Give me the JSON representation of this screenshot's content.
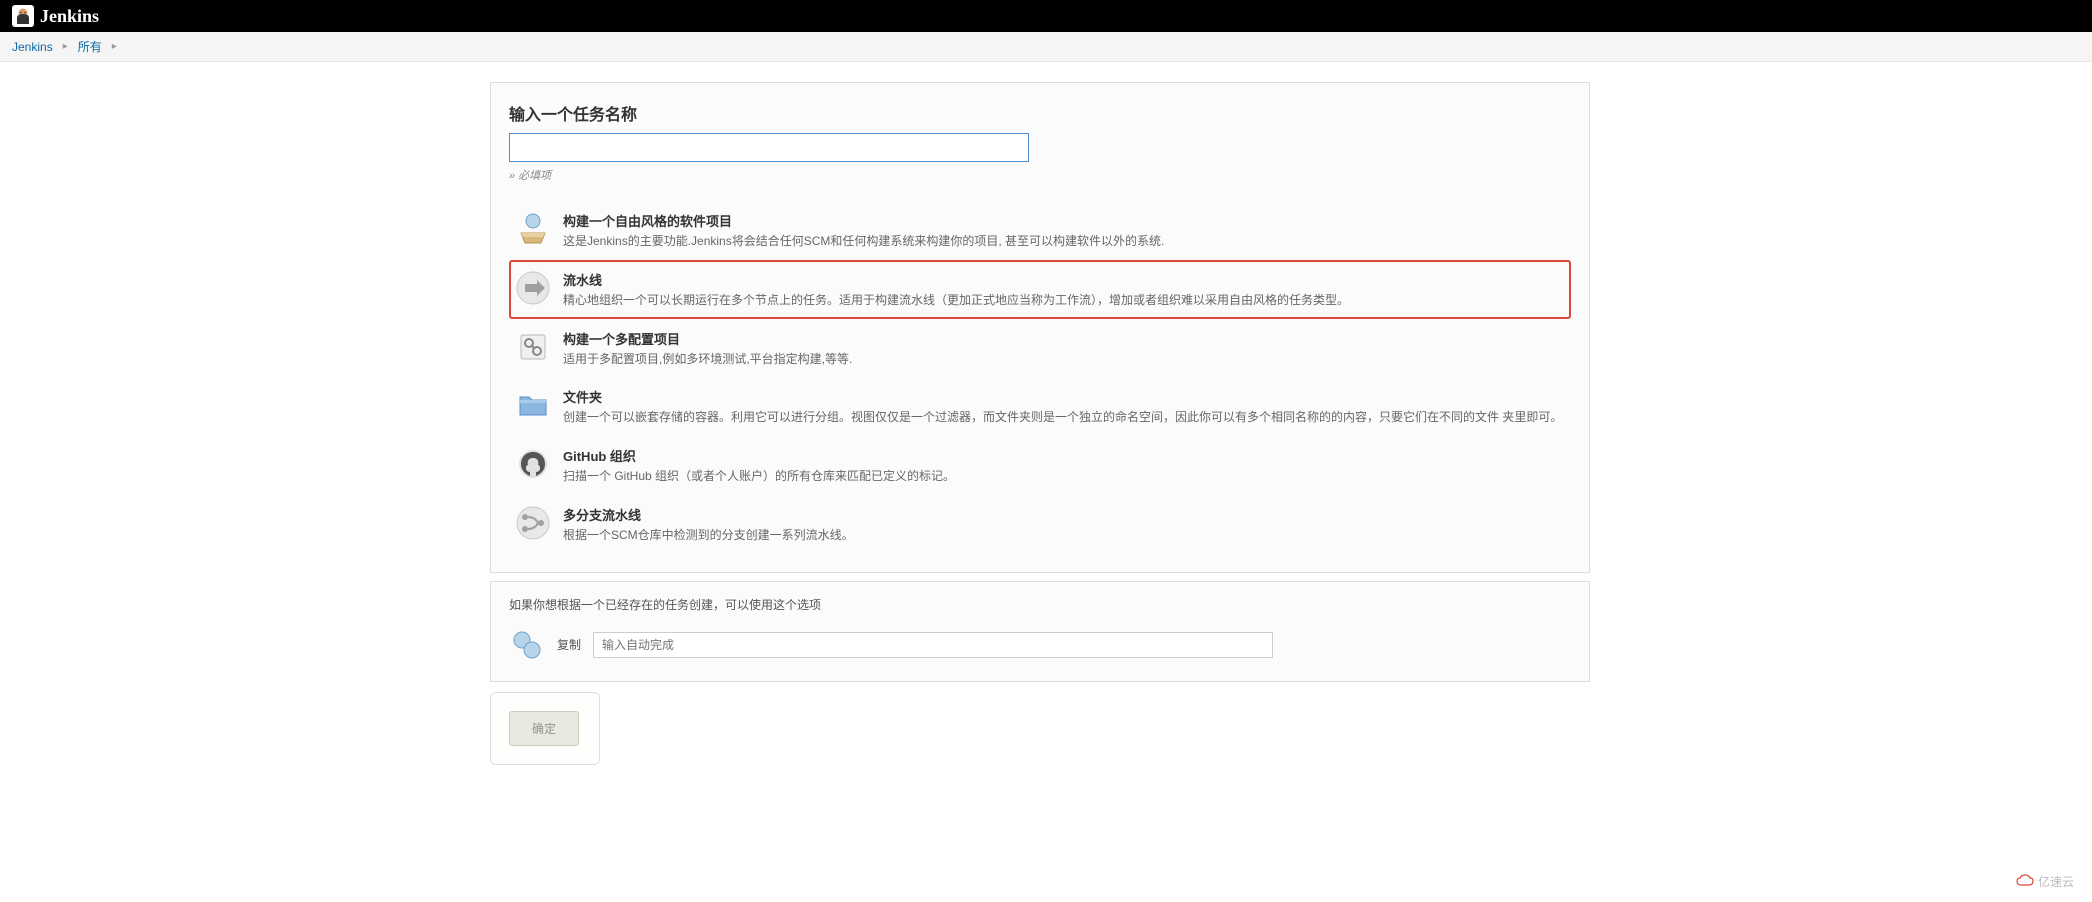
{
  "header": {
    "logo_text": "Jenkins"
  },
  "breadcrumbs": [
    {
      "label": "Jenkins"
    },
    {
      "label": "所有"
    }
  ],
  "name_section": {
    "title": "输入一个任务名称",
    "value": "",
    "required_text": "» 必填项"
  },
  "items": [
    {
      "title": "构建一个自由风格的软件项目",
      "desc": "这是Jenkins的主要功能.Jenkins将会结合任何SCM和任何构建系统来构建你的项目, 甚至可以构建软件以外的系统.",
      "icon": "freestyle-icon",
      "highlighted": false
    },
    {
      "title": "流水线",
      "desc": "精心地组织一个可以长期运行在多个节点上的任务。适用于构建流水线（更加正式地应当称为工作流），增加或者组织难以采用自由风格的任务类型。",
      "icon": "pipeline-icon",
      "highlighted": true
    },
    {
      "title": "构建一个多配置项目",
      "desc": "适用于多配置项目,例如多环境测试,平台指定构建,等等.",
      "icon": "multiconfig-icon",
      "highlighted": false
    },
    {
      "title": "文件夹",
      "desc": "创建一个可以嵌套存储的容器。利用它可以进行分组。视图仅仅是一个过滤器，而文件夹则是一个独立的命名空间，因此你可以有多个相同名称的的内容，只要它们在不同的文件 夹里即可。",
      "icon": "folder-icon",
      "highlighted": false
    },
    {
      "title": "GitHub 组织",
      "desc": "扫描一个 GitHub 组织（或者个人账户）的所有仓库来匹配已定义的标记。",
      "icon": "github-icon",
      "highlighted": false
    },
    {
      "title": "多分支流水线",
      "desc": "根据一个SCM仓库中检测到的分支创建一系列流水线。",
      "icon": "multibranch-icon",
      "highlighted": false
    }
  ],
  "copy_section": {
    "intro": "如果你想根据一个已经存在的任务创建，可以使用这个选项",
    "label": "复制",
    "placeholder": "输入自动完成"
  },
  "footer": {
    "ok_label": "确定"
  },
  "watermark": "亿速云"
}
